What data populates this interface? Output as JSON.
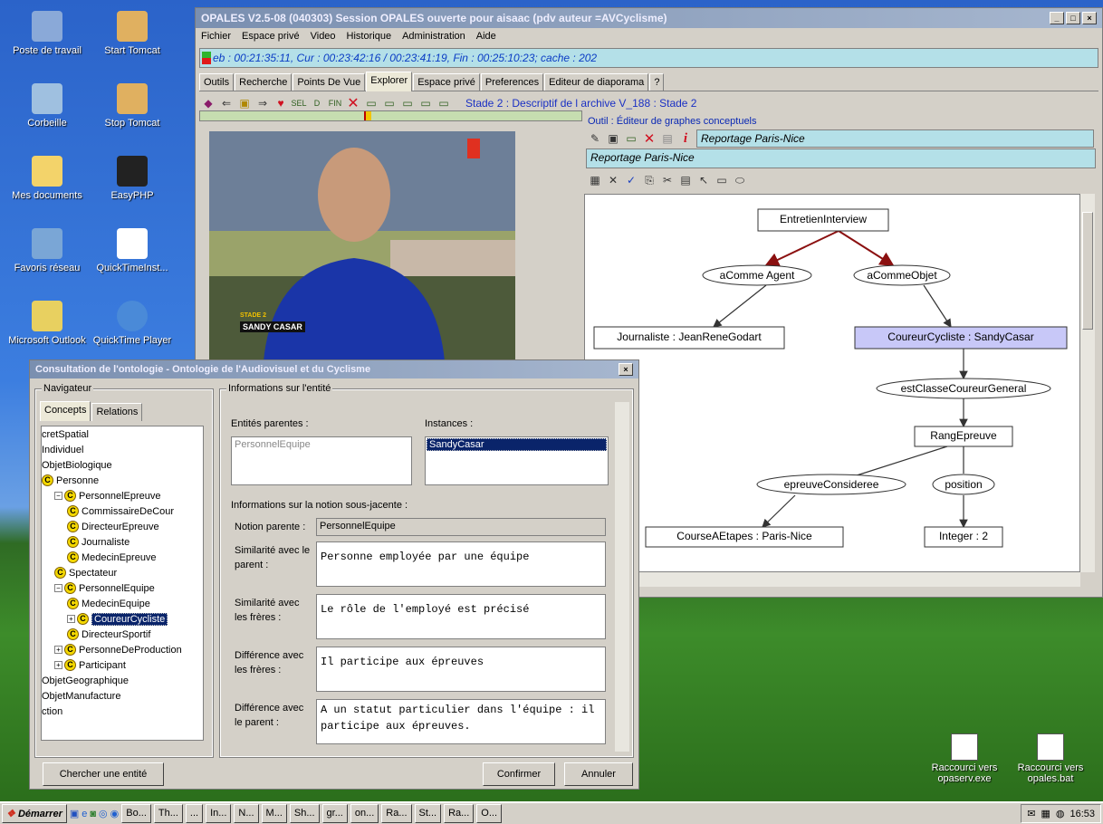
{
  "desktop": {
    "icons": [
      {
        "label": "Poste de travail",
        "color": "#8aa9d8"
      },
      {
        "label": "Start Tomcat",
        "color": "#e0b060"
      },
      {
        "label": "Corbeille",
        "color": "#9fc0e0"
      },
      {
        "label": "Stop Tomcat",
        "color": "#e0b060"
      },
      {
        "label": "Mes documents",
        "color": "#f3d36a"
      },
      {
        "label": "EasyPHP",
        "color": "#222222"
      },
      {
        "label": "Favoris réseau",
        "color": "#7aa6d6"
      },
      {
        "label": "QuickTimeInst...",
        "color": "#ffffff"
      },
      {
        "label": "Microsoft Outlook",
        "color": "#e8d060"
      },
      {
        "label": "QuickTime Player",
        "color": "#4a8ad8"
      }
    ],
    "shortcuts": [
      {
        "label": "Raccourci vers opaserv.exe"
      },
      {
        "label": "Raccourci vers opales.bat"
      }
    ]
  },
  "main_window": {
    "title": "OPALES V2.5-08 (040303)    Session OPALES ouverte pour aisaac (pdv auteur =AVCyclisme)",
    "menu": [
      "Fichier",
      "Espace privé",
      "Video",
      "Historique",
      "Administration",
      "Aide"
    ],
    "timebar": "eb : 00:21:35:11,   Cur : 00:23:42:16 / 00:23:41:19,   Fin : 00:25:10:23;   cache :  202",
    "tabs": [
      "Outils",
      "Recherche",
      "Points De Vue",
      "Explorer",
      "Espace privé",
      "Preferences",
      "Editeur de diaporama",
      "?"
    ],
    "active_tab": "Explorer",
    "breadcrumb": "Stade 2 : Descriptif de l archive V_188 : Stade 2",
    "progress": 0.43
  },
  "video": {
    "caption_top": "STADE 2",
    "caption_name": "SANDY CASAR"
  },
  "editor": {
    "title": "Outil :  Éditeur de graphes conceptuels",
    "field_value": "Reportage Paris-Nice",
    "graph_name": "Reportage Paris-Nice",
    "nodes": {
      "root": "EntretienInterview",
      "rel_agent": "aComme Agent",
      "rel_objet": "aCommeObjet",
      "journaliste": "Journaliste : JeanReneGodart",
      "coureur": "CoureurCycliste : SandyCasar",
      "rel_classe": "estClasseCoureurGeneral",
      "rang": "RangEpreuve",
      "rel_epreuve": "epreuveConsideree",
      "rel_position": "position",
      "course": "CourseAEtapes : Paris-Nice",
      "integer": "Integer : 2"
    }
  },
  "dialog": {
    "title": "Consultation de l'ontologie - Ontologie de l'Audiovisuel et du Cyclisme",
    "navigator_label": "Navigateur",
    "tabs": [
      "Concepts",
      "Relations"
    ],
    "tree": [
      {
        "label": "cretSpatial",
        "level": 0,
        "icon": false
      },
      {
        "label": "Individuel",
        "level": 0,
        "icon": false
      },
      {
        "label": "ObjetBiologique",
        "level": 0,
        "icon": false
      },
      {
        "label": "Personne",
        "level": 0,
        "icon": true
      },
      {
        "label": "PersonnelEpreuve",
        "level": 1,
        "icon": true,
        "toggle": "−"
      },
      {
        "label": "CommissaireDeCour",
        "level": 2,
        "icon": true
      },
      {
        "label": "DirecteurEpreuve",
        "level": 2,
        "icon": true
      },
      {
        "label": "Journaliste",
        "level": 2,
        "icon": true
      },
      {
        "label": "MedecinEpreuve",
        "level": 2,
        "icon": true
      },
      {
        "label": "Spectateur",
        "level": 1,
        "icon": true
      },
      {
        "label": "PersonnelEquipe",
        "level": 1,
        "icon": true,
        "toggle": "−"
      },
      {
        "label": "MedecinEquipe",
        "level": 2,
        "icon": true
      },
      {
        "label": "CoureurCycliste",
        "level": 2,
        "icon": true,
        "selected": true,
        "toggle": "+"
      },
      {
        "label": "DirecteurSportif",
        "level": 2,
        "icon": true
      },
      {
        "label": "PersonneDeProduction",
        "level": 1,
        "icon": true,
        "toggle": "+"
      },
      {
        "label": "Participant",
        "level": 1,
        "icon": true,
        "toggle": "+"
      },
      {
        "label": "ObjetGeographique",
        "level": 0,
        "icon": false
      },
      {
        "label": "ObjetManufacture",
        "level": 0,
        "icon": false
      },
      {
        "label": "ction",
        "level": 0,
        "icon": false
      }
    ],
    "info_label": "Informations sur l'entité",
    "parents_label": "Entités parentes :",
    "parents_value": "PersonnelEquipe",
    "instances_label": "Instances :",
    "instances_value": "SandyCasar",
    "notion_header": "Informations sur la notion sous-jacente :",
    "notion_parent_label": "Notion parente :",
    "notion_parent_value": "PersonnelEquipe",
    "sim_parent_label": "Similarité avec le parent :",
    "sim_parent_value": "Personne employée par une équipe",
    "sim_freres_label": "Similarité avec les frères :",
    "sim_freres_value": "Le rôle de l'employé est précisé",
    "diff_freres_label": "Différence avec les frères :",
    "diff_freres_value": "Il participe aux épreuves",
    "diff_parent_label": "Différence avec le parent :",
    "diff_parent_value": "A un statut particulier dans l'équipe : il participe aux épreuves.",
    "search_button": "Chercher une entité",
    "confirm_button": "Confirmer",
    "cancel_button": "Annuler"
  },
  "taskbar": {
    "start": "Démarrer",
    "tasks": [
      "Bo...",
      "Th...",
      "...",
      "In...",
      "N...",
      "M...",
      "Sh...",
      "gr...",
      "on...",
      "Ra...",
      "St...",
      "Ra...",
      "O..."
    ],
    "clock": "16:53"
  }
}
